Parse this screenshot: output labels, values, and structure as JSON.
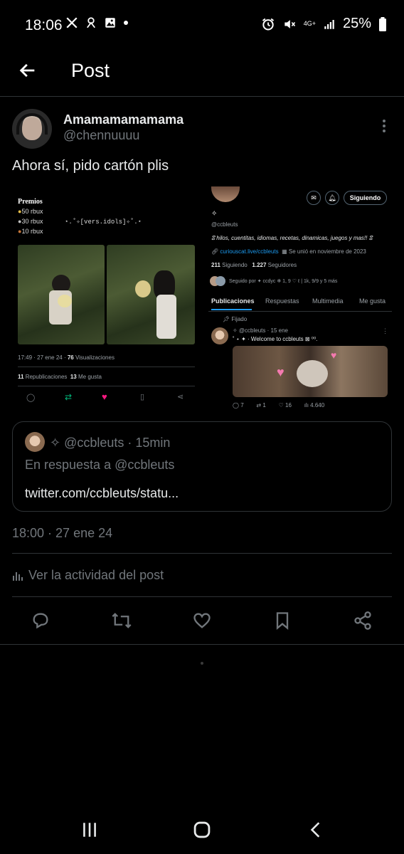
{
  "status_bar": {
    "time": "18:06",
    "battery": "25%",
    "network": "4G+"
  },
  "header": {
    "title": "Post"
  },
  "post": {
    "display_name": "Amamamamamama",
    "handle": "@chennuuuu",
    "text": "Ahora sí, pido cartón plis",
    "timestamp": "18:00 · 27 ene 24",
    "activity_label": "Ver la actividad del post"
  },
  "media": {
    "prizes_title": "Premios",
    "prizes": [
      "50 rbux",
      "30 rbux",
      "10 rbux"
    ],
    "vers_text": "⋆.˚✧[vers.idols]✧˚.⋆",
    "left_meta_time": "17:49 · 27 ene 24 · ",
    "left_meta_views_count": "76",
    "left_meta_views_label": " Visualizaciones",
    "reposts_count": "11",
    "reposts_label": " Republicaciones",
    "likes_count": "13",
    "likes_label": " Me gusta",
    "follow_button": "Siguiendo",
    "profile_handle": "@ccbleuts",
    "profile_bio": "ⵓ hilos, cuentitas, idiomas, recetas, dinamicas, juegos y mas!! ⵓ",
    "profile_link": "curiouscat.live/ccbleuts",
    "profile_joined": "Se unió en noviembre de 2023",
    "following_count": "211",
    "following_label": " Siguiendo",
    "followers_count": "1.227",
    "followers_label": " Seguidores",
    "followed_by": "Seguido por ✦ ccdyc ❄ 1, 9 ♡ ℓ | 1k, 9/9 y 5 más",
    "tabs": [
      "Publicaciones",
      "Respuestas",
      "Multimedia",
      "Me gusta"
    ],
    "pinned_label": "Fijado",
    "pinned_header": "✧ @ccbleuts · 15 ene",
    "pinned_text": "˚ ⋆ ✦ · Welcome to ccbleuts ⊠ ⁰⁰.",
    "pinned_stats": [
      "7",
      "1",
      "16",
      "4.640"
    ]
  },
  "quote": {
    "handle": "✧ @ccbleuts · 15min",
    "reply_to": "En respuesta a @ccbleuts",
    "link": "twitter.com/ccbleuts/statu..."
  },
  "colors": {
    "background": "#000000",
    "text": "#e7e9ea",
    "muted": "#71767b",
    "divider": "#2f3336",
    "link": "#1d9bf0",
    "like": "#f91880",
    "repost": "#00ba7c"
  }
}
